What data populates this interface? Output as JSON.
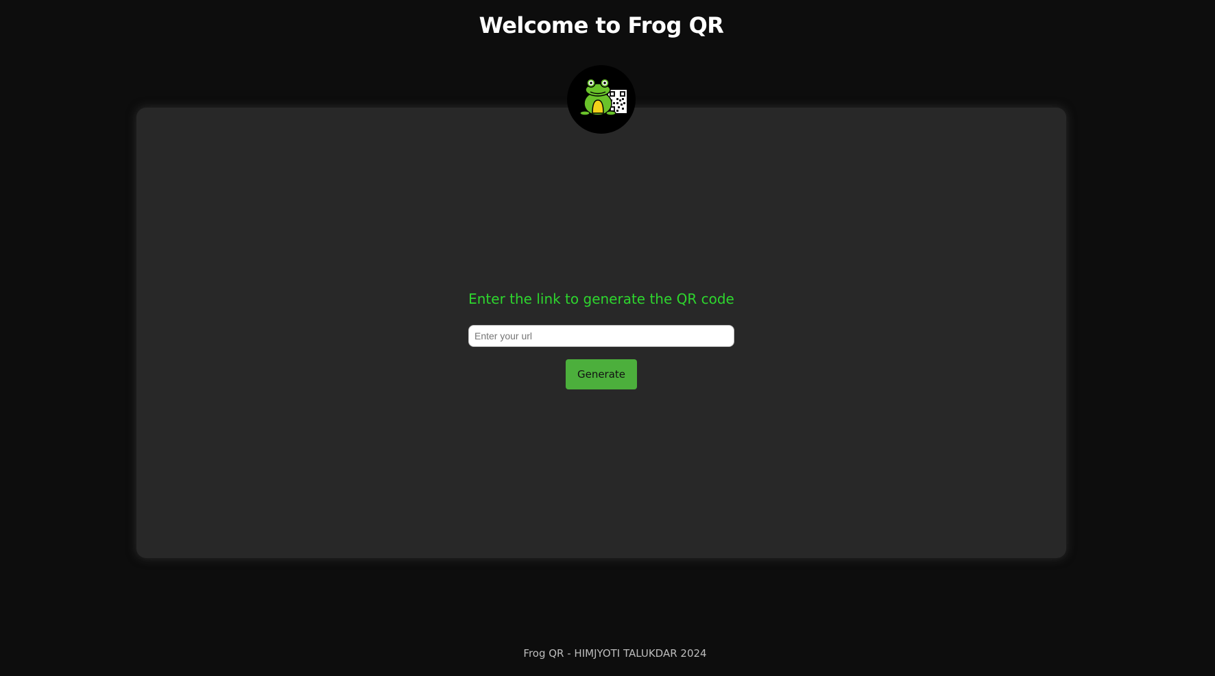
{
  "header": {
    "title": "Welcome to Frog QR"
  },
  "logo": {
    "icon": "frog-qr-logo-icon"
  },
  "main": {
    "prompt": "Enter the link to generate the QR code",
    "url_input": {
      "value": "",
      "placeholder": "Enter your url"
    },
    "generate_label": "Generate"
  },
  "footer": {
    "text": "Frog QR - HIMJYOTI TALUKDAR 2024"
  },
  "colors": {
    "background": "#0d0d0d",
    "panel": "#282828",
    "accent_text": "#2ed62e",
    "button": "#4caf3c"
  }
}
